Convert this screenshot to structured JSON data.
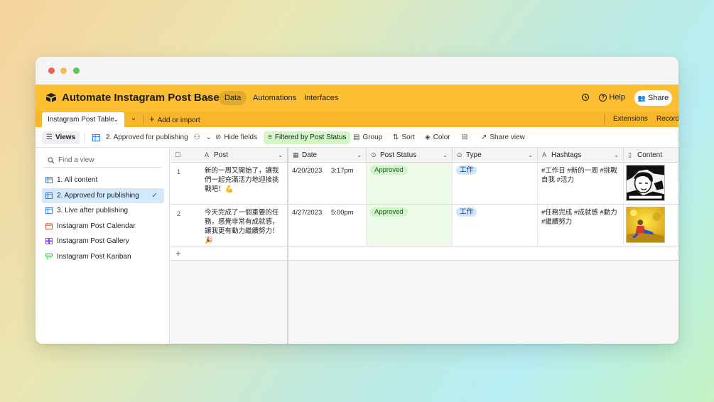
{
  "app": {
    "base_title": "Automate Instagram Post Base",
    "nav_tabs": [
      "Data",
      "Automations",
      "Interfaces"
    ],
    "help_label": "Help",
    "share_label": "Share",
    "accent_color": "#fcbe32"
  },
  "tablebar": {
    "table_tab": "Instagram Post Table",
    "add_import": "Add or import",
    "extensions": "Extensions",
    "records": "Record"
  },
  "viewbar": {
    "views_label": "Views",
    "current_view": "2. Approved for publishing",
    "hide_fields": "Hide fields",
    "filtered": "Filtered by Post Status",
    "group": "Group",
    "sort": "Sort",
    "color": "Color",
    "share_view": "Share view"
  },
  "sidebar": {
    "search_placeholder": "Find a view",
    "items": [
      {
        "label": "1. All content",
        "icon": "grid-icon"
      },
      {
        "label": "2. Approved for publishing",
        "icon": "grid-icon",
        "active": true
      },
      {
        "label": "3. Live after publishing",
        "icon": "grid-icon"
      },
      {
        "label": "Instagram Post Calendar",
        "icon": "calendar-icon"
      },
      {
        "label": "Instagram Post Gallery",
        "icon": "gallery-icon"
      },
      {
        "label": "Instagram Post Kanban",
        "icon": "kanban-icon"
      }
    ]
  },
  "table": {
    "columns": [
      "Post",
      "Date",
      "Post Status",
      "Type",
      "Hashtags",
      "Content"
    ],
    "rows": [
      {
        "num": "1",
        "post": "新的一周又開始了，讓我們一起充滿活力地迎接挑戰吧！💪",
        "date": "4/20/2023",
        "time": "3:17pm",
        "status": "Approved",
        "type": "工作",
        "hashtags": "#工作日 #新的一周 #挑戰自我 #活力"
      },
      {
        "num": "2",
        "post": "今天完成了一個重要的任務，感覺非常有成就感，讓我更有動力繼續努力！🎉",
        "date": "4/27/2023",
        "time": "5:00pm",
        "status": "Approved",
        "type": "工作",
        "hashtags": "#任務完成 #成就感 #動力 #繼續努力"
      }
    ]
  }
}
